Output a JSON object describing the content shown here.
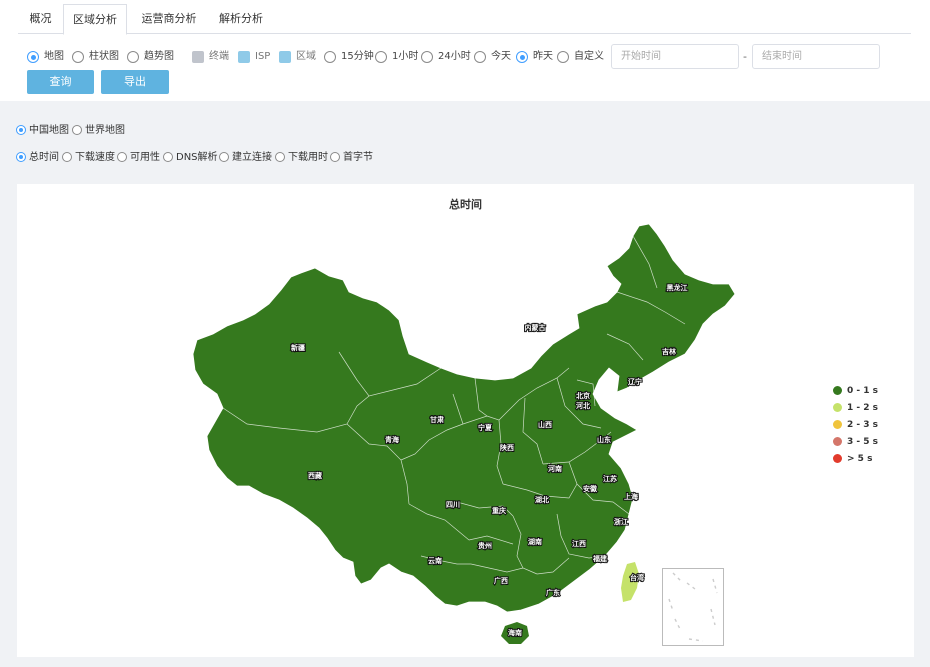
{
  "tabs": [
    {
      "label": "概况",
      "active": false
    },
    {
      "label": "区域分析",
      "active": true
    },
    {
      "label": "运营商分析",
      "active": false
    },
    {
      "label": "解析分析",
      "active": false
    }
  ],
  "filters": {
    "chart_types": [
      {
        "label": "地图",
        "selected": true
      },
      {
        "label": "柱状图",
        "selected": false
      },
      {
        "label": "趋势图",
        "selected": false
      }
    ],
    "dimensions": [
      {
        "label": "终端",
        "style": "grey"
      },
      {
        "label": "ISP",
        "style": "blue"
      },
      {
        "label": "区域",
        "style": "blue"
      }
    ],
    "time_ranges": [
      {
        "label": "15分钟",
        "selected": false
      },
      {
        "label": "1小时",
        "selected": false
      },
      {
        "label": "24小时",
        "selected": false
      },
      {
        "label": "今天",
        "selected": false
      },
      {
        "label": "昨天",
        "selected": true
      },
      {
        "label": "自定义",
        "selected": false
      }
    ],
    "start_placeholder": "开始时间",
    "end_placeholder": "结束时间",
    "separator": "-"
  },
  "actions": {
    "query": "查询",
    "export": "导出"
  },
  "map_scope": [
    {
      "label": "中国地图",
      "selected": true
    },
    {
      "label": "世界地图",
      "selected": false
    }
  ],
  "metrics": [
    {
      "label": "总时间",
      "selected": true
    },
    {
      "label": "下载速度",
      "selected": false
    },
    {
      "label": "可用性",
      "selected": false
    },
    {
      "label": "DNS解析",
      "selected": false
    },
    {
      "label": "建立连接",
      "selected": false
    },
    {
      "label": "下载用时",
      "selected": false
    },
    {
      "label": "首字节",
      "selected": false
    }
  ],
  "map": {
    "title": "总时间",
    "legend": [
      {
        "label": "0 - 1 s",
        "color": "#35791e"
      },
      {
        "label": "1 - 2 s",
        "color": "#c5e26a"
      },
      {
        "label": "2 - 3 s",
        "color": "#f0c43c"
      },
      {
        "label": "3 - 5 s",
        "color": "#d4766a"
      },
      {
        "label": "> 5 s",
        "color": "#e23b2c"
      }
    ],
    "colors": {
      "main": "#35791e",
      "taiwan": "#c5e26a",
      "border": "#ffffff"
    },
    "provinces": [
      {
        "name": "黑龙江",
        "bucket": "0 - 1 s"
      },
      {
        "name": "内蒙古",
        "bucket": "0 - 1 s"
      },
      {
        "name": "新疆",
        "bucket": "0 - 1 s"
      },
      {
        "name": "吉林",
        "bucket": "0 - 1 s"
      },
      {
        "name": "辽宁",
        "bucket": "0 - 1 s"
      },
      {
        "name": "北京",
        "bucket": "0 - 1 s"
      },
      {
        "name": "河北",
        "bucket": "0 - 1 s"
      },
      {
        "name": "甘肃",
        "bucket": "0 - 1 s"
      },
      {
        "name": "宁夏",
        "bucket": "0 - 1 s"
      },
      {
        "name": "山西",
        "bucket": "0 - 1 s"
      },
      {
        "name": "山东",
        "bucket": "0 - 1 s"
      },
      {
        "name": "青海",
        "bucket": "0 - 1 s"
      },
      {
        "name": "陕西",
        "bucket": "0 - 1 s"
      },
      {
        "name": "河南",
        "bucket": "0 - 1 s"
      },
      {
        "name": "江苏",
        "bucket": "0 - 1 s"
      },
      {
        "name": "西藏",
        "bucket": "0 - 1 s"
      },
      {
        "name": "安徽",
        "bucket": "0 - 1 s"
      },
      {
        "name": "上海",
        "bucket": "0 - 1 s"
      },
      {
        "name": "四川",
        "bucket": "0 - 1 s"
      },
      {
        "name": "湖北",
        "bucket": "0 - 1 s"
      },
      {
        "name": "重庆",
        "bucket": "0 - 1 s"
      },
      {
        "name": "浙江",
        "bucket": "0 - 1 s"
      },
      {
        "name": "贵州",
        "bucket": "0 - 1 s"
      },
      {
        "name": "湖南",
        "bucket": "0 - 1 s"
      },
      {
        "name": "江西",
        "bucket": "0 - 1 s"
      },
      {
        "name": "云南",
        "bucket": "0 - 1 s"
      },
      {
        "name": "福建",
        "bucket": "0 - 1 s"
      },
      {
        "name": "广西",
        "bucket": "0 - 1 s"
      },
      {
        "name": "广东",
        "bucket": "0 - 1 s"
      },
      {
        "name": "台湾",
        "bucket": "1 - 2 s"
      },
      {
        "name": "海南",
        "bucket": "0 - 1 s"
      }
    ]
  }
}
